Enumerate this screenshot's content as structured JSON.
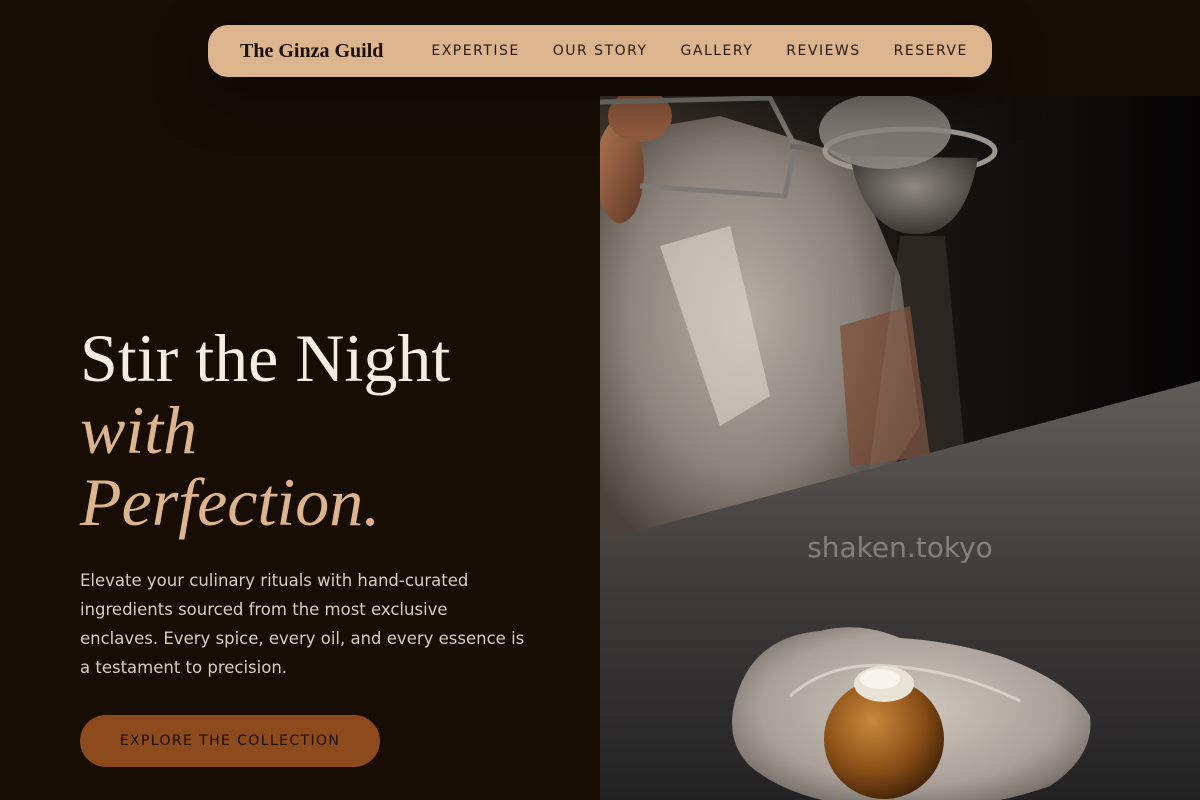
{
  "nav": {
    "brand": "The Ginza Guild",
    "links": [
      {
        "label": "EXPERTISE"
      },
      {
        "label": "OUR STORY"
      },
      {
        "label": "GALLERY"
      },
      {
        "label": "REVIEWS"
      },
      {
        "label": "RESERVE"
      }
    ]
  },
  "hero": {
    "headline_line1": "Stir the Night",
    "headline_line2": "with",
    "headline_line3": "Perfection.",
    "description": "Elevate your culinary rituals with hand-curated ingredients sourced from the most exclusive enclaves. Every spice, every oil, and every essence is a testament to precision.",
    "cta_label": "EXPLORE THE COLLECTION"
  },
  "photo": {
    "watermark": "shaken.tokyo"
  },
  "colors": {
    "background": "#170d05",
    "nav_background": "#dcb48e",
    "accent": "#dcb48e",
    "cta_background": "#8c4a1d"
  }
}
